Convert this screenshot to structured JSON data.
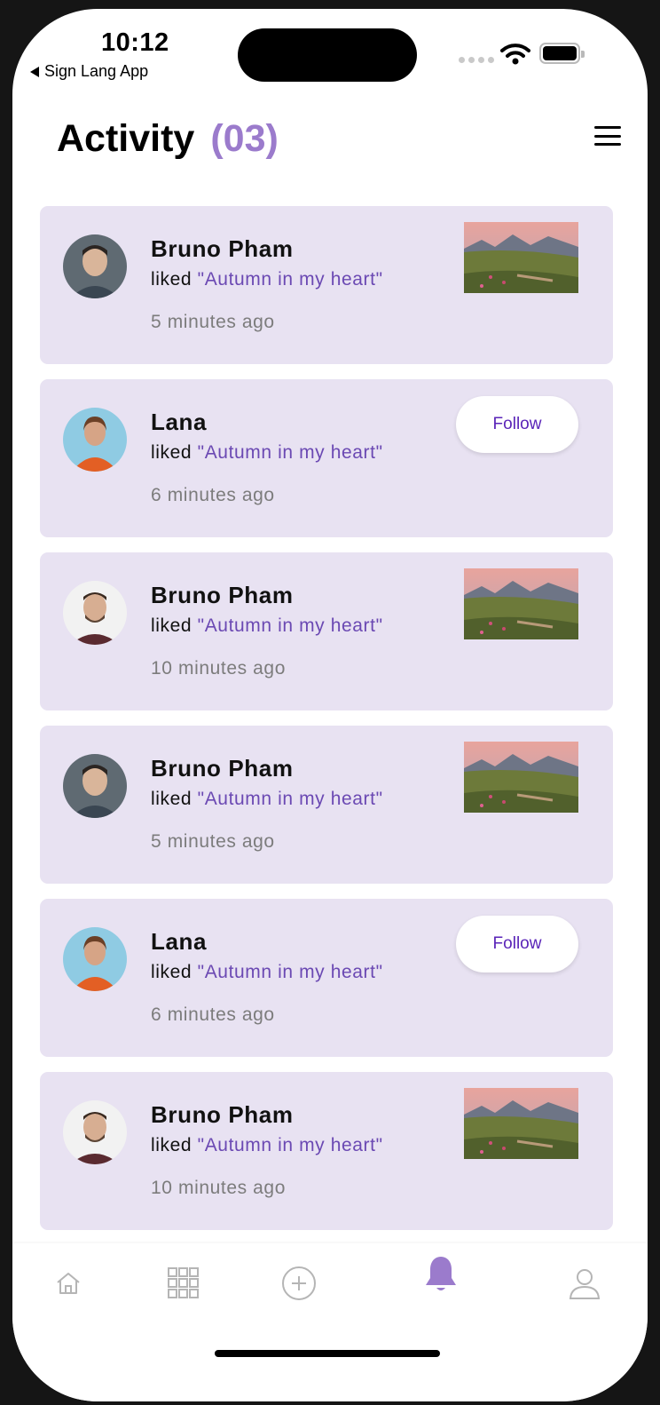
{
  "status_bar": {
    "time": "10:12",
    "back_label": "Sign Lang App"
  },
  "header": {
    "title": "Activity",
    "count": "(03)"
  },
  "activities": [
    {
      "name": "Bruno Pham",
      "action": "liked",
      "post": "\"Autumn in my heart\"",
      "time": "5 minutes ago",
      "trailing": "thumbnail"
    },
    {
      "name": "Lana",
      "action": "liked",
      "post": "\"Autumn in my heart\"",
      "time": "6 minutes ago",
      "trailing": "follow",
      "follow_label": "Follow"
    },
    {
      "name": "Bruno Pham",
      "action": "liked",
      "post": "\"Autumn in my heart\"",
      "time": "10 minutes ago",
      "trailing": "thumbnail"
    },
    {
      "name": "Bruno Pham",
      "action": "liked",
      "post": "\"Autumn in my heart\"",
      "time": "5 minutes ago",
      "trailing": "thumbnail"
    },
    {
      "name": "Lana",
      "action": "liked",
      "post": "\"Autumn in my heart\"",
      "time": "6 minutes ago",
      "trailing": "follow",
      "follow_label": "Follow"
    },
    {
      "name": "Bruno Pham",
      "action": "liked",
      "post": "\"Autumn in my heart\"",
      "time": "10 minutes ago",
      "trailing": "thumbnail"
    }
  ],
  "tabbar": {
    "items": [
      {
        "icon": "home-icon",
        "active": false
      },
      {
        "icon": "grid-icon",
        "active": false
      },
      {
        "icon": "add-circle-icon",
        "active": false
      },
      {
        "icon": "bell-icon",
        "active": true
      },
      {
        "icon": "profile-icon",
        "active": false
      }
    ]
  },
  "colors": {
    "accent": "#9b7bcc",
    "card_bg": "#e8e2f2",
    "post_link": "#6b49b3",
    "follow_text": "#5a24b8"
  }
}
